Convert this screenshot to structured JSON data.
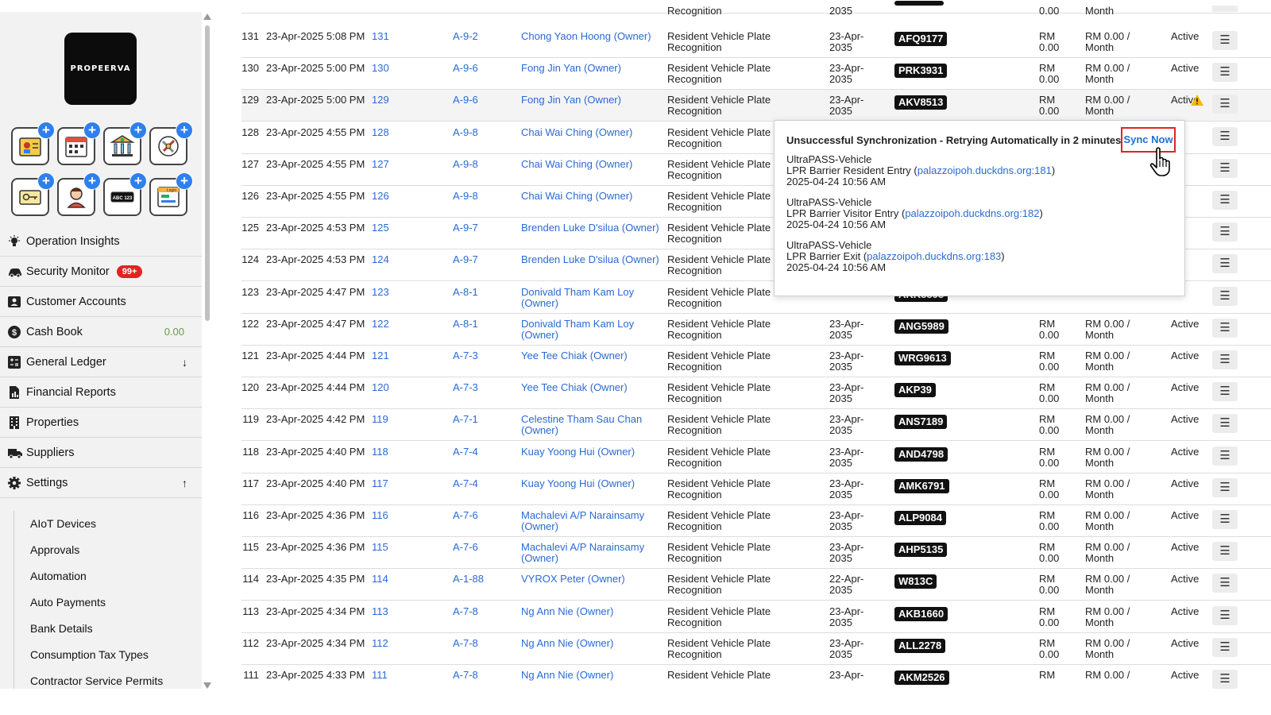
{
  "sidebar": {
    "logo_text": "PROPEERVA",
    "tiles": [
      {
        "icon": "staff-id-icon"
      },
      {
        "icon": "calendar-icon"
      },
      {
        "icon": "bank-icon"
      },
      {
        "icon": "tools-icon"
      },
      {
        "icon": "access-card-icon"
      },
      {
        "icon": "resident-icon"
      },
      {
        "icon": "plate-reader-icon"
      },
      {
        "icon": "login-panel-icon"
      }
    ],
    "tile_badge_text": "ABC 123",
    "tile_login_text": "Login",
    "items": [
      {
        "label": "Operation Insights",
        "icon": "lightbulb-icon"
      },
      {
        "label": "Security Monitor",
        "icon": "car-icon",
        "badge": "99+"
      },
      {
        "label": "Customer Accounts",
        "icon": "account-icon"
      },
      {
        "label": "Cash Book",
        "icon": "dollar-icon",
        "value": "0.00"
      },
      {
        "label": "General Ledger",
        "icon": "ledger-icon",
        "arrow": "↓"
      },
      {
        "label": "Financial Reports",
        "icon": "report-icon"
      },
      {
        "label": "Properties",
        "icon": "building-icon"
      },
      {
        "label": "Suppliers",
        "icon": "truck-icon"
      },
      {
        "label": "Settings",
        "icon": "gear-icon",
        "arrow": "↑"
      }
    ],
    "sub_items": [
      "AIoT Devices",
      "Approvals",
      "Automation",
      "Auto Payments",
      "Bank Details",
      "Consumption Tax Types",
      "Contractor Service Permits"
    ]
  },
  "colors": {
    "link": "#2a6ad4",
    "badge": "#e02424",
    "plate_bg": "#111111",
    "warning": "#f5b800"
  },
  "top_partial": {
    "type": "Recognition",
    "expiry": "2035",
    "amount": "0.00",
    "rate": "Month"
  },
  "rows": [
    {
      "no": "131",
      "date": "23-Apr-2025 5:08 PM",
      "ref": "131",
      "unit": "A-9-2",
      "name": "Chong Yaon Hoong (Owner)",
      "type": "Resident Vehicle Plate Recognition",
      "expiry": "23-Apr-2035",
      "plate": "AFQ9177",
      "amount": "RM 0.00",
      "rate": "RM 0.00 / Month",
      "status": "Active"
    },
    {
      "no": "130",
      "date": "23-Apr-2025 5:00 PM",
      "ref": "130",
      "unit": "A-9-6",
      "name": "Fong Jin Yan (Owner)",
      "type": "Resident Vehicle Plate Recognition",
      "expiry": "23-Apr-2035",
      "plate": "PRK3931",
      "amount": "RM 0.00",
      "rate": "RM 0.00 / Month",
      "status": "Active"
    },
    {
      "no": "129",
      "date": "23-Apr-2025 5:00 PM",
      "ref": "129",
      "unit": "A-9-6",
      "name": "Fong Jin Yan (Owner)",
      "type": "Resident Vehicle Plate Recognition",
      "expiry": "23-Apr-2035",
      "plate": "AKV8513",
      "amount": "RM 0.00",
      "rate": "RM 0.00 / Month",
      "status": "Active",
      "warning": true
    },
    {
      "no": "128",
      "date": "23-Apr-2025 4:55 PM",
      "ref": "128",
      "unit": "A-9-8",
      "name": "Chai Wai Ching (Owner)",
      "type": "Resident Vehicle Plate Recognition",
      "expiry": "",
      "plate": "",
      "amount": "",
      "rate": "",
      "status": ""
    },
    {
      "no": "127",
      "date": "23-Apr-2025 4:55 PM",
      "ref": "127",
      "unit": "A-9-8",
      "name": "Chai Wai Ching (Owner)",
      "type": "Resident Vehicle Plate Recognition",
      "expiry": "",
      "plate": "",
      "amount": "",
      "rate": "",
      "status": ""
    },
    {
      "no": "126",
      "date": "23-Apr-2025 4:55 PM",
      "ref": "126",
      "unit": "A-9-8",
      "name": "Chai Wai Ching (Owner)",
      "type": "Resident Vehicle Plate Recognition",
      "expiry": "",
      "plate": "",
      "amount": "",
      "rate": "",
      "status": ""
    },
    {
      "no": "125",
      "date": "23-Apr-2025 4:53 PM",
      "ref": "125",
      "unit": "A-9-7",
      "name": "Brenden Luke D'silua (Owner)",
      "type": "Resident Vehicle Plate Recognition",
      "expiry": "",
      "plate": "",
      "amount": "",
      "rate": "",
      "status": ""
    },
    {
      "no": "124",
      "date": "23-Apr-2025 4:53 PM",
      "ref": "124",
      "unit": "A-9-7",
      "name": "Brenden Luke D'silua (Owner)",
      "type": "Resident Vehicle Plate Recognition",
      "expiry": "",
      "plate": "",
      "amount": "",
      "rate": "",
      "status": ""
    },
    {
      "no": "123",
      "date": "23-Apr-2025 4:47 PM",
      "ref": "123",
      "unit": "A-8-1",
      "name": "Donivald Tham Kam Loy (Owner)",
      "type": "Resident Vehicle Plate Recognition",
      "expiry": "2035",
      "plate": "AKK8808",
      "amount": "0.00",
      "rate": "Month",
      "status": ""
    },
    {
      "no": "122",
      "date": "23-Apr-2025 4:47 PM",
      "ref": "122",
      "unit": "A-8-1",
      "name": "Donivald Tham Kam Loy (Owner)",
      "type": "Resident Vehicle Plate Recognition",
      "expiry": "23-Apr-2035",
      "plate": "ANG5989",
      "amount": "RM 0.00",
      "rate": "RM 0.00 / Month",
      "status": "Active"
    },
    {
      "no": "121",
      "date": "23-Apr-2025 4:44 PM",
      "ref": "121",
      "unit": "A-7-3",
      "name": "Yee Tee Chiak (Owner)",
      "type": "Resident Vehicle Plate Recognition",
      "expiry": "23-Apr-2035",
      "plate": "WRG9613",
      "amount": "RM 0.00",
      "rate": "RM 0.00 / Month",
      "status": "Active"
    },
    {
      "no": "120",
      "date": "23-Apr-2025 4:44 PM",
      "ref": "120",
      "unit": "A-7-3",
      "name": "Yee Tee Chiak (Owner)",
      "type": "Resident Vehicle Plate Recognition",
      "expiry": "23-Apr-2035",
      "plate": "AKP39",
      "amount": "RM 0.00",
      "rate": "RM 0.00 / Month",
      "status": "Active"
    },
    {
      "no": "119",
      "date": "23-Apr-2025 4:42 PM",
      "ref": "119",
      "unit": "A-7-1",
      "name": "Celestine Tham Sau Chan (Owner)",
      "type": "Resident Vehicle Plate Recognition",
      "expiry": "23-Apr-2035",
      "plate": "ANS7189",
      "amount": "RM 0.00",
      "rate": "RM 0.00 / Month",
      "status": "Active"
    },
    {
      "no": "118",
      "date": "23-Apr-2025 4:40 PM",
      "ref": "118",
      "unit": "A-7-4",
      "name": "Kuay Yoong Hui (Owner)",
      "type": "Resident Vehicle Plate Recognition",
      "expiry": "23-Apr-2035",
      "plate": "AND4798",
      "amount": "RM 0.00",
      "rate": "RM 0.00 / Month",
      "status": "Active"
    },
    {
      "no": "117",
      "date": "23-Apr-2025 4:40 PM",
      "ref": "117",
      "unit": "A-7-4",
      "name": "Kuay Yoong Hui (Owner)",
      "type": "Resident Vehicle Plate Recognition",
      "expiry": "23-Apr-2035",
      "plate": "AMK6791",
      "amount": "RM 0.00",
      "rate": "RM 0.00 / Month",
      "status": "Active"
    },
    {
      "no": "116",
      "date": "23-Apr-2025 4:36 PM",
      "ref": "116",
      "unit": "A-7-6",
      "name": "Machalevi A/P Narainsamy (Owner)",
      "type": "Resident Vehicle Plate Recognition",
      "expiry": "23-Apr-2035",
      "plate": "ALP9084",
      "amount": "RM 0.00",
      "rate": "RM 0.00 / Month",
      "status": "Active"
    },
    {
      "no": "115",
      "date": "23-Apr-2025 4:36 PM",
      "ref": "115",
      "unit": "A-7-6",
      "name": "Machalevi A/P Narainsamy (Owner)",
      "type": "Resident Vehicle Plate Recognition",
      "expiry": "23-Apr-2035",
      "plate": "AHP5135",
      "amount": "RM 0.00",
      "rate": "RM 0.00 / Month",
      "status": "Active"
    },
    {
      "no": "114",
      "date": "23-Apr-2025 4:35 PM",
      "ref": "114",
      "unit": "A-1-88",
      "name": "VYROX Peter (Owner)",
      "type": "Resident Vehicle Plate Recognition",
      "expiry": "22-Apr-2035",
      "plate": "W813C",
      "amount": "RM 0.00",
      "rate": "RM 0.00 / Month",
      "status": "Active"
    },
    {
      "no": "113",
      "date": "23-Apr-2025 4:34 PM",
      "ref": "113",
      "unit": "A-7-8",
      "name": "Ng Ann Nie (Owner)",
      "type": "Resident Vehicle Plate Recognition",
      "expiry": "23-Apr-2035",
      "plate": "AKB1660",
      "amount": "RM 0.00",
      "rate": "RM 0.00 / Month",
      "status": "Active"
    },
    {
      "no": "112",
      "date": "23-Apr-2025 4:34 PM",
      "ref": "112",
      "unit": "A-7-8",
      "name": "Ng Ann Nie (Owner)",
      "type": "Resident Vehicle Plate Recognition",
      "expiry": "23-Apr-2035",
      "plate": "ALL2278",
      "amount": "RM 0.00",
      "rate": "RM 0.00 / Month",
      "status": "Active"
    },
    {
      "no": "111",
      "date": "23-Apr-2025 4:33 PM",
      "ref": "111",
      "unit": "A-7-8",
      "name": "Ng Ann Nie (Owner)",
      "type": "Resident Vehicle Plate",
      "expiry": "23-Apr-",
      "plate": "AKM2526",
      "amount": "RM",
      "rate": "RM 0.00 /",
      "status": "Active"
    }
  ],
  "popup": {
    "title": "Unsuccessful Synchronization - Retrying Automatically in 2 minutes",
    "sync_button": "Sync Now",
    "entries": [
      {
        "device": "UltraPASS-Vehicle",
        "desc": "LPR Barrier Resident Entry",
        "host": "palazzoipoh.duckdns.org:181",
        "time": "2025-04-24 10:56 AM"
      },
      {
        "device": "UltraPASS-Vehicle",
        "desc": "LPR Barrier Visitor Entry",
        "host": "palazzoipoh.duckdns.org:182",
        "time": "2025-04-24 10:56 AM"
      },
      {
        "device": "UltraPASS-Vehicle",
        "desc": "LPR Barrier Exit",
        "host": "palazzoipoh.duckdns.org:183",
        "time": "2025-04-24 10:56 AM"
      }
    ]
  }
}
